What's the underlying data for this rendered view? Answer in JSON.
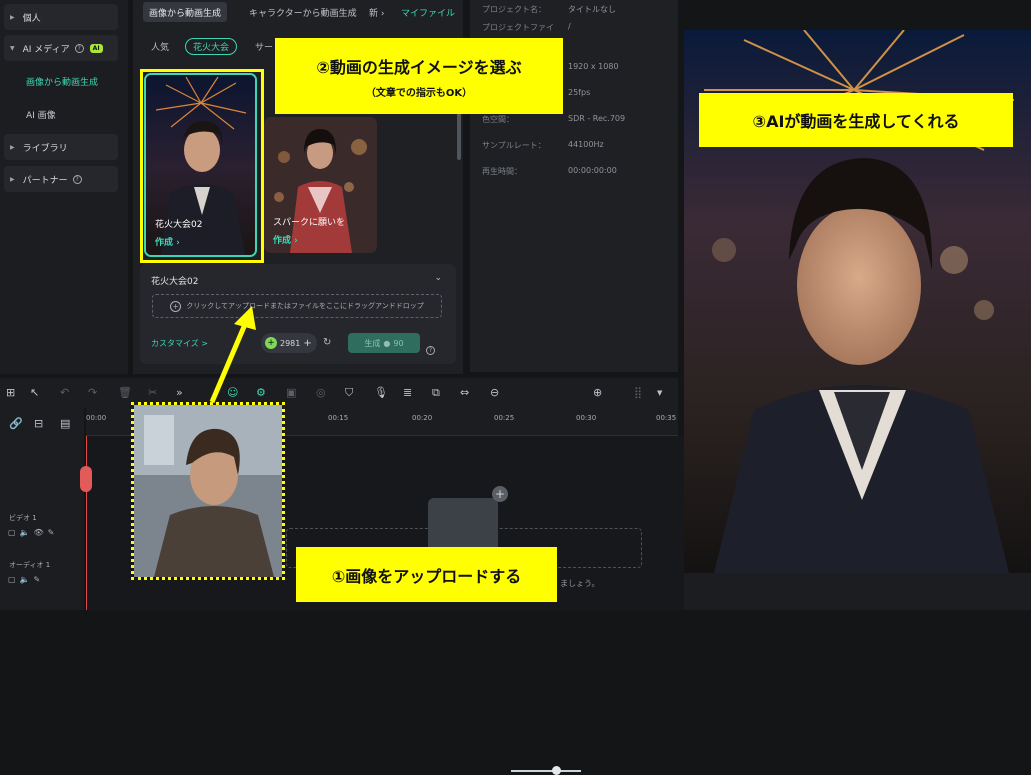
{
  "sidebar": {
    "items": [
      {
        "label": "個人"
      },
      {
        "label": "AI メディア",
        "badge": "AI"
      },
      {
        "label": "ライブラリ"
      },
      {
        "label": "パートナー"
      }
    ],
    "sub_items": [
      {
        "label": "画像から動画生成",
        "active": true
      },
      {
        "label": "AI 画像",
        "active": false
      }
    ]
  },
  "center": {
    "tabs": [
      "画像から動画生成",
      "キャラクターから動画生成",
      "新 ›",
      "マイファイル"
    ],
    "chips": [
      "人気",
      "花火大会",
      "サー"
    ],
    "cards": [
      {
        "title": "花火大会02",
        "action": "作成 ›"
      },
      {
        "title": "スパークに願いを",
        "action": "作成 ›"
      }
    ],
    "detail": {
      "title": "花火大会02",
      "drop_text": "クリックしてアップロードまたはファイルをここにドラッグアンドドロップ",
      "customize": "カスタマイズ >",
      "credits": "2981",
      "generate_label": "生成",
      "generate_cost": "90"
    }
  },
  "info": {
    "rows": [
      {
        "label": "プロジェクト名：",
        "value": "タイトルなし"
      },
      {
        "label": "プロジェクトファイ",
        "value": "/"
      },
      {
        "label": "",
        "value": "1920 x 1080"
      },
      {
        "label": "",
        "value": "25fps"
      },
      {
        "label": "色空間：",
        "value": "SDR - Rec.709"
      },
      {
        "label": "サンプルレート：",
        "value": "44100Hz"
      },
      {
        "label": "再生時間：",
        "value": "00:00:00:00"
      }
    ]
  },
  "timeline": {
    "ticks": [
      "00:00",
      "00:15",
      "00:20",
      "00:25",
      "00:30",
      "00:35"
    ],
    "tracks": [
      {
        "label": "ビデオ 1"
      },
      {
        "label": "オーディオ 1"
      }
    ],
    "drop_hint": "ましょう。"
  },
  "annotations": {
    "step1": "①画像をアップロードする",
    "step2_title": "②動画の生成イメージを選ぶ",
    "step2_sub": "（文章での指示もOK）",
    "step3": "③AIが動画を生成してくれる"
  },
  "colors": {
    "accent": "#3ed6b4",
    "highlight": "#ffff00",
    "badge": "#a8e63a"
  }
}
